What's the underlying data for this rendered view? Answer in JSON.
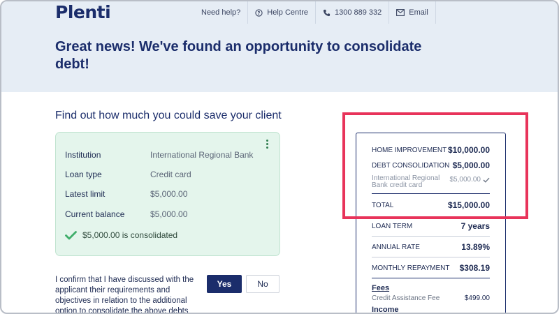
{
  "header": {
    "logo_text": "Plenti",
    "need_help": "Need help?",
    "help_centre": "Help Centre",
    "phone": "1300 889 332",
    "email": "Email",
    "title": "Great news! We've found an opportunity to consolidate debt!"
  },
  "section": {
    "title": "Find out how much you could save your client"
  },
  "debt_card": {
    "rows": [
      {
        "label": "Institution",
        "value": "International Regional Bank"
      },
      {
        "label": "Loan type",
        "value": "Credit card"
      },
      {
        "label": "Latest limit",
        "value": "$5,000.00"
      },
      {
        "label": "Current balance",
        "value": "$5,000.00"
      }
    ],
    "consolidated_text": "$5,000.00 is consolidated"
  },
  "confirm": {
    "text": "I confirm that I have discussed with the applicant their requirements and objectives in relation to the additional option to consolidate the above debts",
    "yes_label": "Yes",
    "no_label": "No"
  },
  "summary": {
    "home_improvement_label": "HOME IMPROVEMENT",
    "home_improvement_amount": "$10,000.00",
    "debt_consolidation_label": "DEBT CONSOLIDATION",
    "debt_consolidation_amount": "$5,000.00",
    "bank_label": "International Regional Bank credit card",
    "bank_amount": "$5,000.00",
    "total_label": "TOTAL",
    "total_amount": "$15,000.00",
    "loan_term_label": "LOAN TERM",
    "loan_term_value": "7 years",
    "annual_rate_label": "ANNUAL RATE",
    "annual_rate_value": "13.89%",
    "monthly_repayment_label": "MONTHLY REPAYMENT",
    "monthly_repayment_value": "$308.19",
    "fees_heading": "Fees",
    "credit_assistance_fee_label": "Credit Assistance Fee",
    "credit_assistance_fee_value": "$499.00",
    "income_heading": "Income"
  },
  "colors": {
    "brand_navy": "#1b2d6b",
    "hero_bg": "#e6edf5",
    "card_green_bg": "#e4f5ec",
    "check_green": "#3fae6a",
    "highlight_red": "#e8335a"
  },
  "icons": {
    "help": "question-circle-icon",
    "phone": "phone-icon",
    "email": "envelope-icon",
    "menu": "kebab-menu-icon",
    "consolidated": "check-icon",
    "bank_selected": "small-check-icon"
  }
}
